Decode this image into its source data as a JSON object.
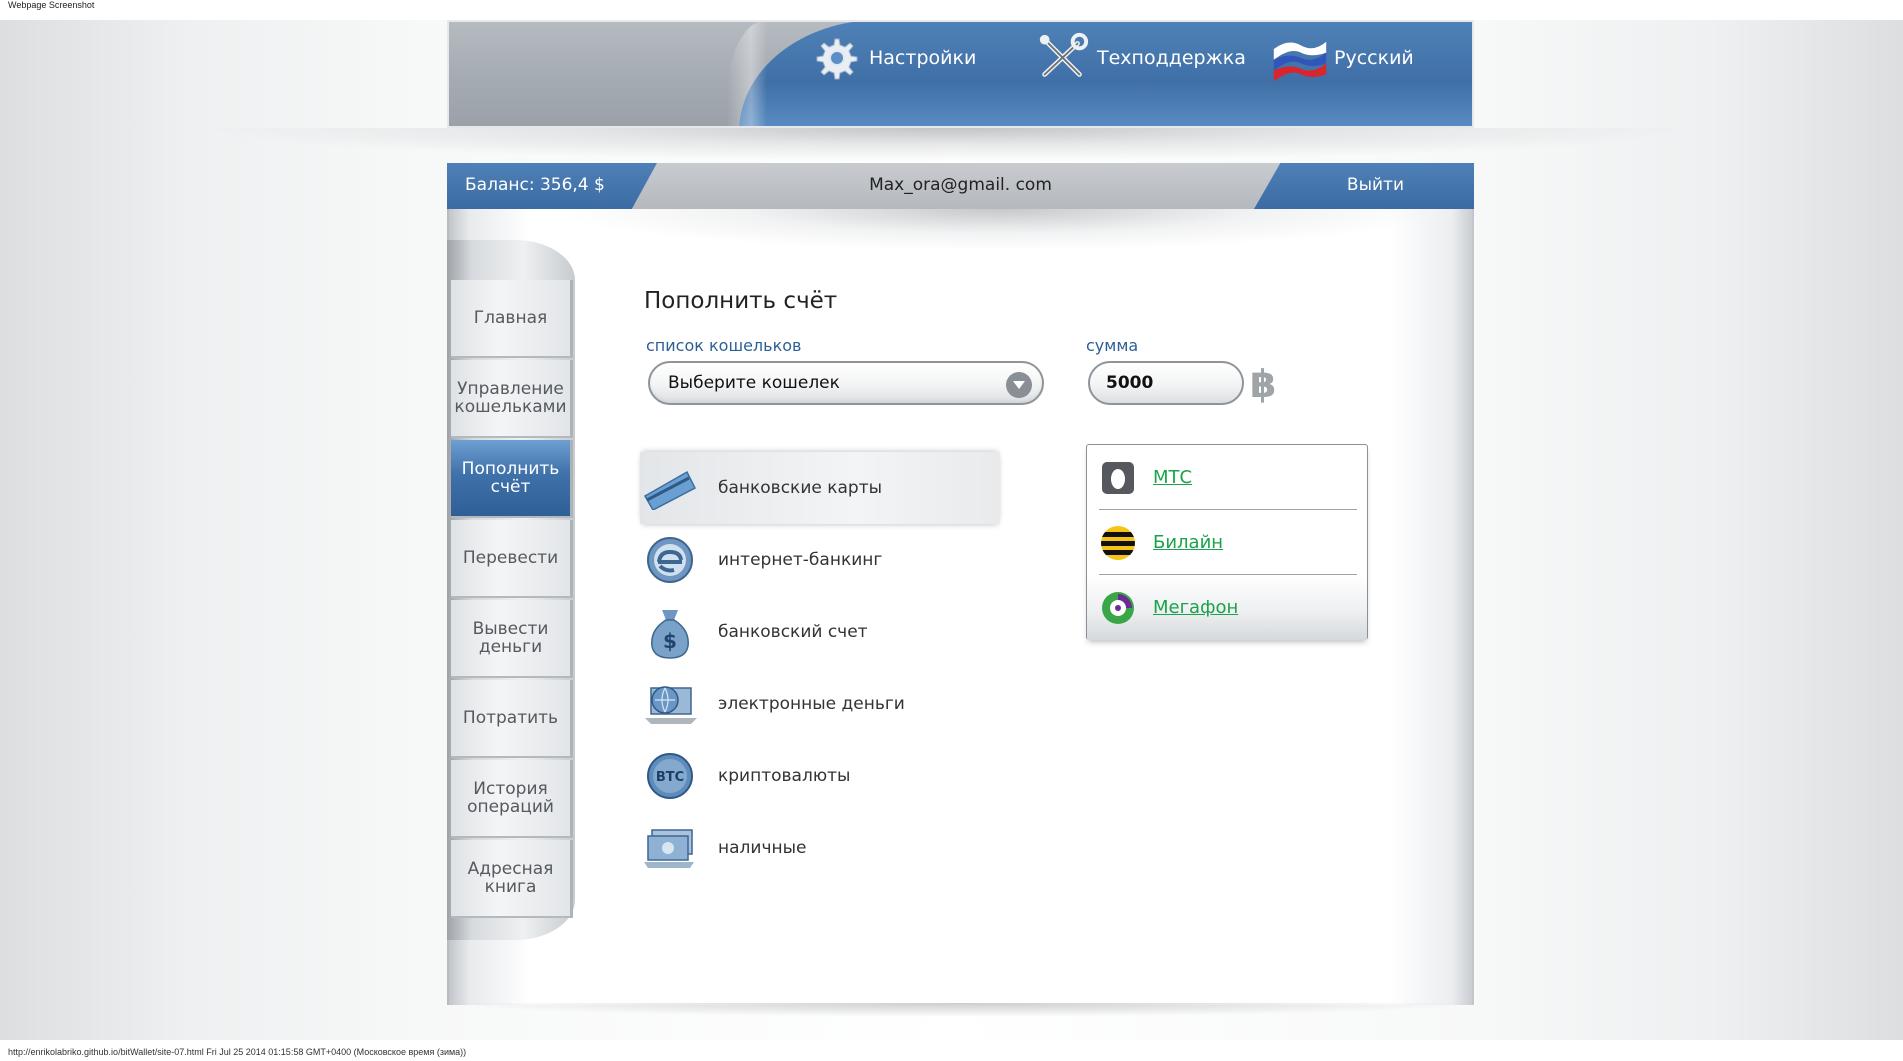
{
  "caption": "Webpage Screenshot",
  "footer": "http://enrikolabriko.github.io/bitWallet/site-07.html Fri Jul 25 2014 01:15:58 GMT+0400 (Московское время (зима))",
  "top_nav": {
    "settings": "Настройки",
    "support": "Техподдержка",
    "language": "Русский"
  },
  "account_bar": {
    "balance": "Баланс: 356,4 $",
    "email": "Max_ora@gmail. com",
    "logout": "Выйти"
  },
  "sidebar": {
    "items": [
      {
        "label": "Главная"
      },
      {
        "label": "Управление кошельками"
      },
      {
        "label": "Пополнить счёт",
        "active": true
      },
      {
        "label": "Перевести"
      },
      {
        "label": "Вывести деньги"
      },
      {
        "label": "Потратить"
      },
      {
        "label": "История операций"
      },
      {
        "label": "Адресная книга"
      }
    ]
  },
  "main": {
    "title": "Пополнить счёт",
    "wallet_label": "список кошельков",
    "wallet_select_value": "Выберите кошелек",
    "amount_label": "сумма",
    "amount_value": "5000",
    "currency_symbol": "฿"
  },
  "methods": [
    {
      "label": "банковские карты",
      "icon": "credit-card-icon",
      "selected": true
    },
    {
      "label": "интернет-банкинг",
      "icon": "internet-explorer-icon"
    },
    {
      "label": "банковский счет",
      "icon": "money-bag-icon"
    },
    {
      "label": "электронные деньги",
      "icon": "globe-laptop-icon"
    },
    {
      "label": "криптовалюты",
      "icon": "btc-coin-icon"
    },
    {
      "label": "наличные",
      "icon": "cash-icon"
    }
  ],
  "mobile_operators": [
    {
      "label": "МТС",
      "icon": "mts-egg-icon"
    },
    {
      "label": "Билайн",
      "icon": "beeline-stripes-icon"
    },
    {
      "label": "Мегафон",
      "icon": "megafon-logo-icon",
      "highlighted": true
    }
  ],
  "colors": {
    "accent_blue": "#3f6fa6",
    "link_green": "#1aa34a",
    "label_blue": "#2d5f95"
  }
}
